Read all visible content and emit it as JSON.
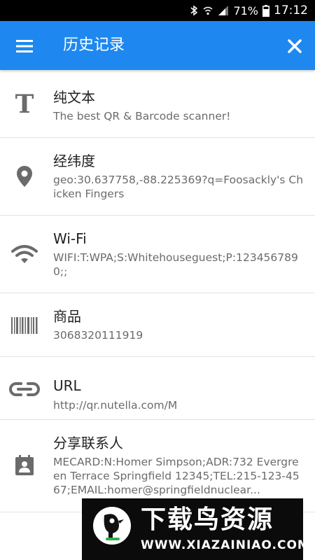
{
  "status_bar": {
    "battery": "71%",
    "time": "17:12"
  },
  "app_bar": {
    "title": "历史记录"
  },
  "history": {
    "items": [
      {
        "icon": "text-t-icon",
        "title": "纯文本",
        "subtitle": "The best QR & Barcode scanner!"
      },
      {
        "icon": "location-pin-icon",
        "title": "经纬度",
        "subtitle": "geo:30.637758,-88.225369?q=Foosackly's Chicken Fingers"
      },
      {
        "icon": "wifi-icon",
        "title": "Wi-Fi",
        "subtitle": "WIFI:T:WPA;S:Whitehouseguest;P:1234567890;;"
      },
      {
        "icon": "barcode-icon",
        "title": "商品",
        "subtitle": "3068320111919"
      },
      {
        "icon": "link-icon",
        "title": "URL",
        "subtitle": "http://qr.nutella.com/M"
      },
      {
        "icon": "contact-card-icon",
        "title": "分享联系人",
        "subtitle": "MECARD:N:Homer Simpson;ADR:732 Evergreen Terrace Springfield 12345;TEL:215-123-4567;EMAIL:homer@springfieldnuclear..."
      }
    ]
  },
  "watermark": {
    "title": "下载鸟资源",
    "url": "WWW.XIAZAINIAO.COM"
  }
}
